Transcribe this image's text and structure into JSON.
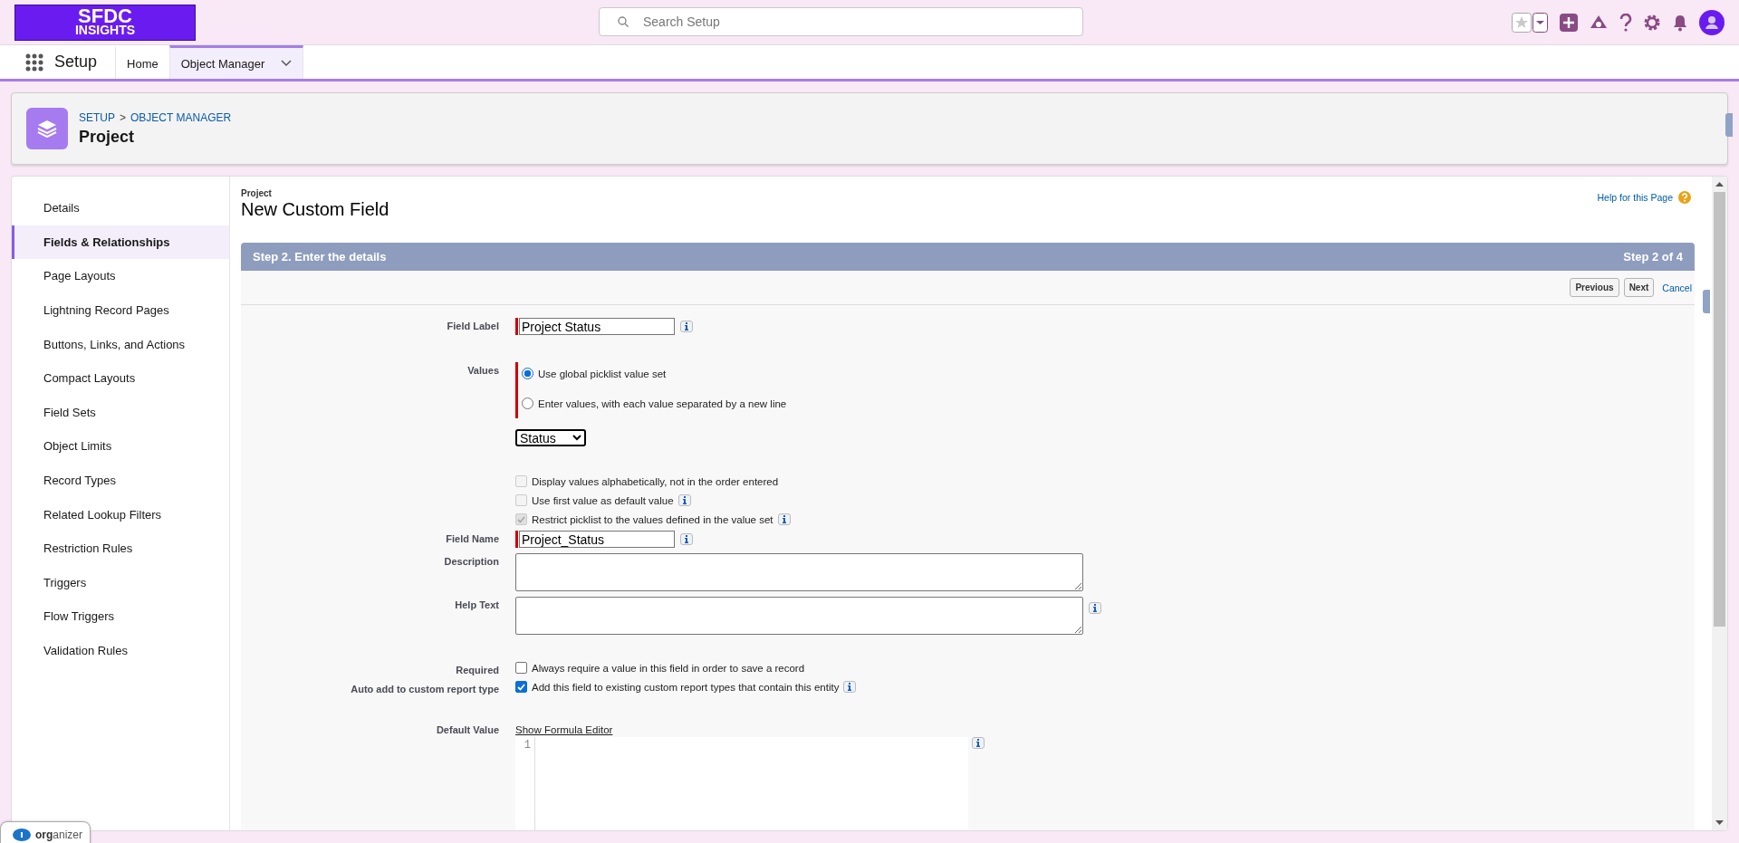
{
  "header": {
    "logo_top": "SFDC",
    "logo_bottom": "INSIGHTS",
    "search": {
      "placeholder": "Search Setup"
    }
  },
  "nav": {
    "app_name": "Setup",
    "tabs": [
      {
        "label": "Home",
        "selected": false,
        "has_menu": false
      },
      {
        "label": "Object Manager",
        "selected": true,
        "has_menu": true
      }
    ]
  },
  "page_header": {
    "breadcrumbs": [
      "SETUP",
      "OBJECT MANAGER"
    ],
    "separator": ">",
    "title": "Project"
  },
  "sidebar": {
    "items": [
      {
        "label": "Details",
        "selected": false
      },
      {
        "label": "Fields & Relationships",
        "selected": true
      },
      {
        "label": "Page Layouts",
        "selected": false
      },
      {
        "label": "Lightning Record Pages",
        "selected": false
      },
      {
        "label": "Buttons, Links, and Actions",
        "selected": false
      },
      {
        "label": "Compact Layouts",
        "selected": false
      },
      {
        "label": "Field Sets",
        "selected": false
      },
      {
        "label": "Object Limits",
        "selected": false
      },
      {
        "label": "Record Types",
        "selected": false
      },
      {
        "label": "Related Lookup Filters",
        "selected": false
      },
      {
        "label": "Restriction Rules",
        "selected": false
      },
      {
        "label": "Triggers",
        "selected": false
      },
      {
        "label": "Flow Triggers",
        "selected": false
      },
      {
        "label": "Validation Rules",
        "selected": false
      }
    ]
  },
  "form": {
    "object": "Project",
    "title": "New Custom Field",
    "help_link": "Help for this Page",
    "step_title": "Step 2. Enter the details",
    "step_count": "Step 2 of 4",
    "buttons": [
      "Previous",
      "Next"
    ],
    "cancel_link": "Cancel",
    "rows": [
      {
        "kind": "text",
        "label": "Field Label",
        "value": "Project Status",
        "required": true,
        "info": true
      },
      {
        "kind": "radio",
        "label": "Values",
        "required": true,
        "options": [
          {
            "label": "Use global picklist value set",
            "selected": true
          },
          {
            "label": "Enter values, with each value separated by a new line",
            "selected": false
          }
        ],
        "select_value": "Status"
      },
      {
        "kind": "checkbox",
        "options": [
          {
            "label": "Display values alphabetically, not in the order entered",
            "checked": false,
            "disabled": true,
            "info": false
          },
          {
            "label": "Use first value as default value",
            "checked": false,
            "disabled": true,
            "info": true
          },
          {
            "label": "Restrict picklist to the values defined in the value set",
            "checked": true,
            "disabled": true,
            "info": true
          }
        ]
      },
      {
        "kind": "text",
        "label": "Field Name",
        "value": "Project_Status",
        "required": true,
        "info": true
      },
      {
        "kind": "textarea",
        "label": "Description",
        "info": false
      },
      {
        "kind": "textarea",
        "label": "Help Text",
        "info": true
      },
      {
        "kind": "checkbox",
        "label": "Required",
        "options": [
          {
            "label": "Always require a value in this field in order to save a record",
            "checked": false,
            "disabled": false,
            "info": false
          }
        ]
      },
      {
        "kind": "checkbox",
        "label": "Auto add to custom report type",
        "options": [
          {
            "label": "Add this field to existing custom report types that contain this entity",
            "checked": true,
            "disabled": false,
            "info": true
          }
        ]
      },
      {
        "kind": "formula",
        "label": "Default Value",
        "link": "Show Formula Editor",
        "line_number": "1",
        "info": true
      }
    ]
  },
  "organizer": {
    "label": "**org**anizer"
  }
}
